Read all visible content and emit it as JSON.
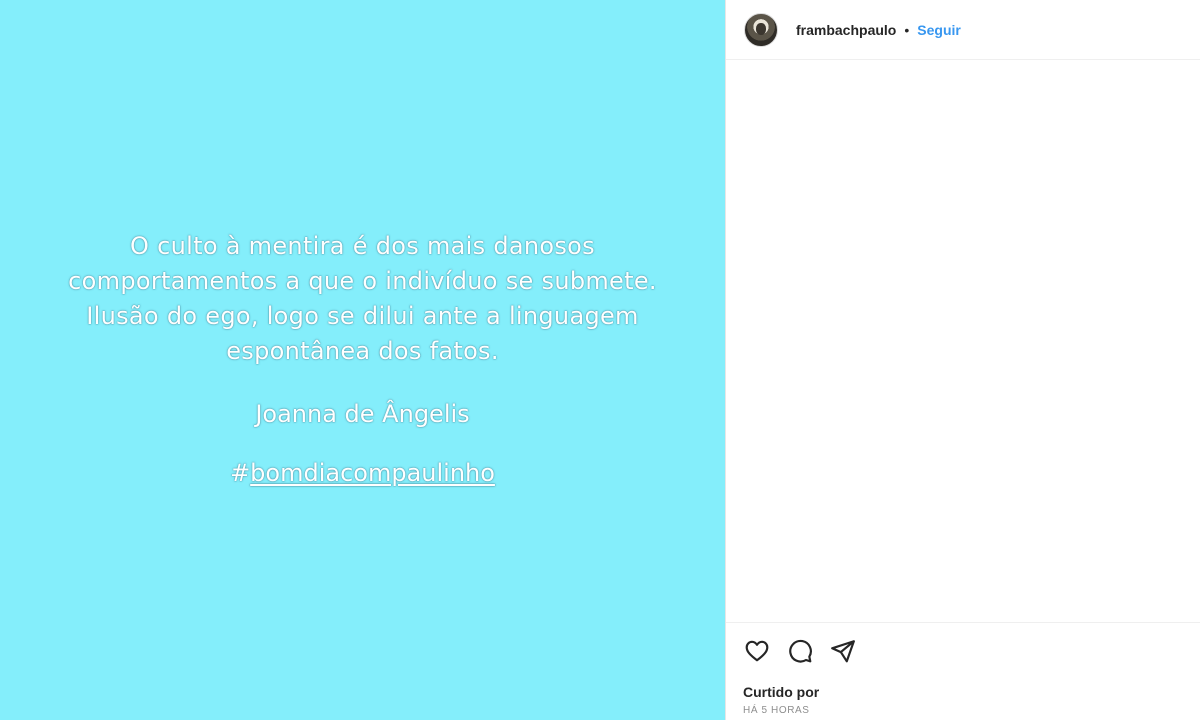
{
  "post": {
    "background_color": "#84eefb",
    "quote_lines": [
      "O culto à mentira é dos mais danosos",
      "comportamentos a que o indivíduo se submete.",
      "Ilusão do ego, logo se dilui ante a linguagem",
      "espontânea dos fatos."
    ],
    "author": "Joanna de Ângelis",
    "hashtag_symbol": "#",
    "hashtag_text": "bomdiacompaulinho"
  },
  "header": {
    "avatar_icon": "user-avatar",
    "username": "frambachpaulo",
    "separator": "•",
    "follow_label": "Seguir",
    "follow_color": "#3897f0"
  },
  "actions": {
    "icons": [
      "heart-icon",
      "comment-icon",
      "share-icon"
    ],
    "liked_by_label": "Curtido por",
    "timestamp": "HÁ 5 HORAS"
  }
}
